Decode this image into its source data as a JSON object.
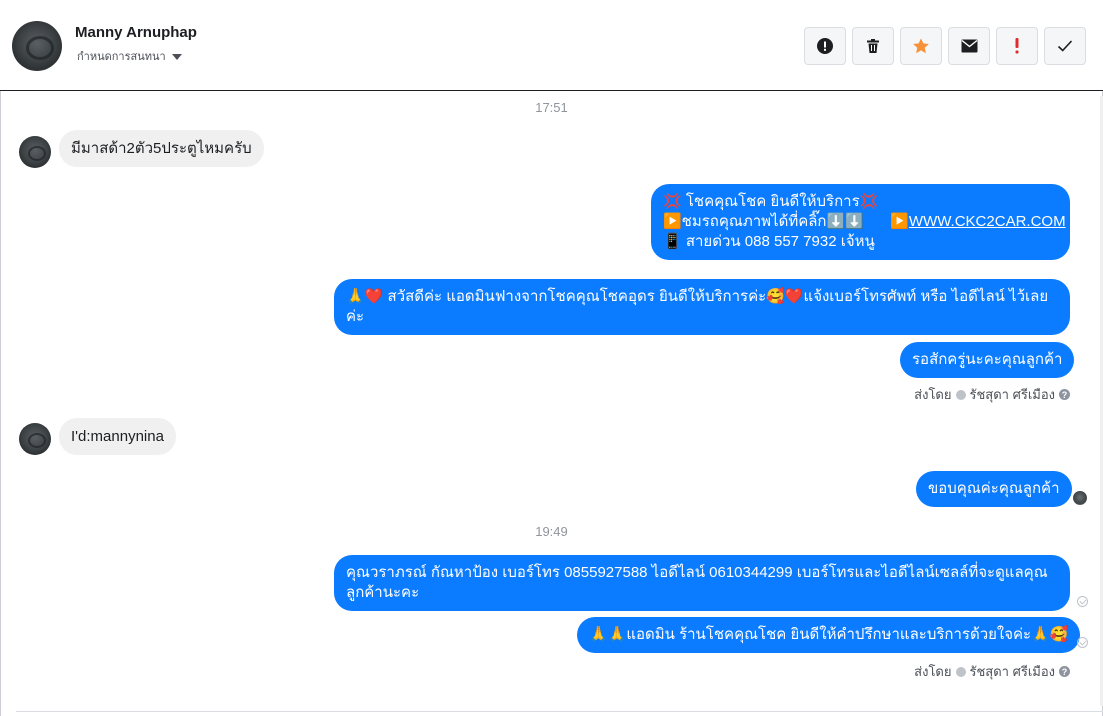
{
  "header": {
    "name": "Manny Arnuphap",
    "assign_label": "กำหนดการสนทนา",
    "actions": [
      {
        "icon": "alert-circle-icon",
        "color": "#1c1e21"
      },
      {
        "icon": "trash-icon",
        "color": "#1c1e21"
      },
      {
        "icon": "star-icon",
        "color": "#f7923a"
      },
      {
        "icon": "envelope-icon",
        "color": "#1c1e21"
      },
      {
        "icon": "exclamation-icon",
        "color": "#e02c2c"
      },
      {
        "icon": "checkmark-icon",
        "color": "#1c1e21"
      }
    ]
  },
  "thread": {
    "time_1": "17:51",
    "msg_in_1": "มีมาสด้า2ตัว5ประตูไหมครับ",
    "msg_out_1": {
      "line1": "💢 โชคคุณโชค ยินดีให้บริการ💢",
      "line2_a": "▶️ชมรถคุณภาพได้ที่คลิ๊ก⬇️⬇️",
      "line2_arrow": "▶️",
      "line2_link": "WWW.CKC2CAR.COM",
      "line3": "📱 สายด่วน 088 557 7932 เจ้หนู"
    },
    "msg_out_2": "🙏❤️ สวัสดีค่ะ แอดมินฟางจากโชคคุณโชคอุดร ยินดีให้บริการค่ะ🥰❤️แจ้งเบอร์โทรศัพท์ หรือ ไอดีไลน์  ไว้เลยค่ะ",
    "msg_out_3": "รอสักครู่นะคะคุณลูกค้า",
    "sent_by_1": "ส่งโดย",
    "sender_1": "รัชสุดา ศรีเมือง",
    "msg_in_2": "I'd:mannynina",
    "msg_out_4": "ขอบคุณค่ะคุณลูกค้า",
    "time_2": "19:49",
    "msg_out_5": "คุณวราภรณ์ กัณหาป้อง  เบอร์โทร 0855927588  ไอดีไลน์ 0610344299   เบอร์โทรและไอดีไลน์เซลล์ที่จะดูแลคุณลูกค้านะคะ",
    "msg_out_6": "🙏🙏แอดมิน ร้านโชคคุณโชค ยินดีให้คำปรึกษาและบริการด้วยใจค่ะ🙏🥰",
    "sent_by_2": "ส่งโดย",
    "sender_2": "รัชสุดา ศรีเมือง"
  },
  "colors": {
    "bubble_out": "#0b7bff",
    "bubble_in": "#f0f0f0"
  }
}
